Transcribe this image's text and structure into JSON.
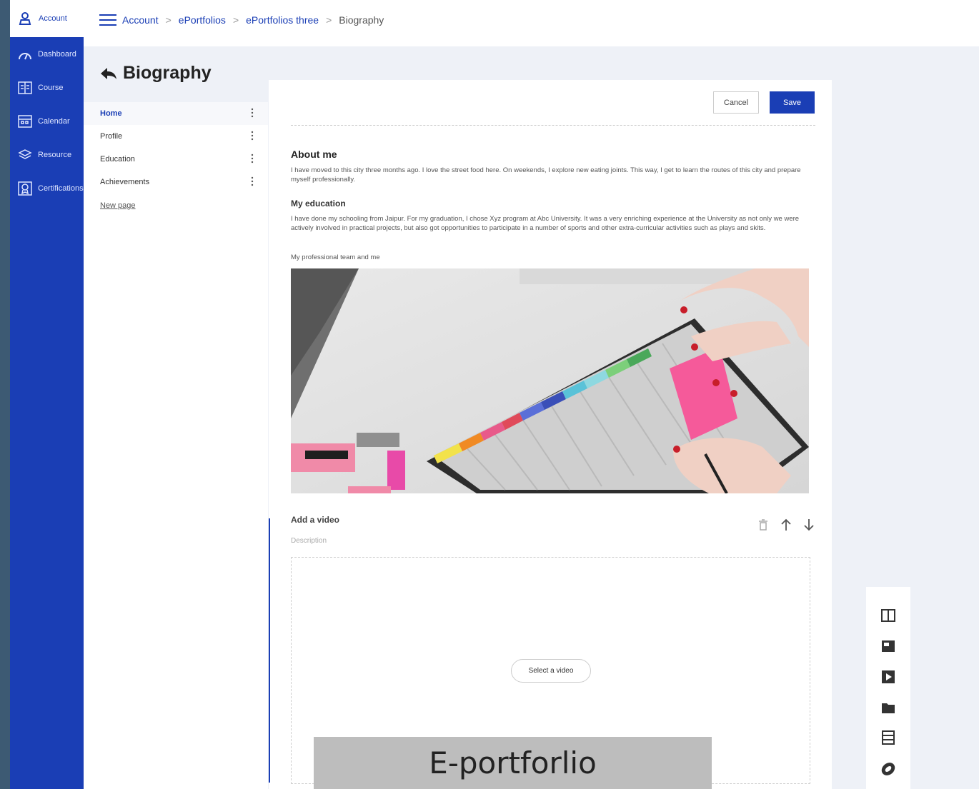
{
  "nav": {
    "account_label": "Account",
    "items": [
      {
        "label": "Dashboard",
        "icon": "dashboard-icon"
      },
      {
        "label": "Course",
        "icon": "course-icon"
      },
      {
        "label": "Calendar",
        "icon": "calendar-icon"
      },
      {
        "label": "Resource",
        "icon": "resource-icon"
      },
      {
        "label": "Certifications",
        "icon": "certifications-icon"
      }
    ]
  },
  "breadcrumb": {
    "items": [
      "Account",
      "ePortfolios",
      "ePortfolios three"
    ],
    "current": "Biography"
  },
  "page": {
    "title": "Biography"
  },
  "pages": {
    "items": [
      {
        "label": "Home",
        "active": true
      },
      {
        "label": "Profile"
      },
      {
        "label": "Education"
      },
      {
        "label": "Achievements"
      }
    ],
    "new_page": "New page"
  },
  "editor": {
    "cancel": "Cancel",
    "save": "Save",
    "about_title": "About me",
    "about_text": "I have moved to this city three months ago. I love the street food here. On weekends, I explore new eating joints. This way, I get to learn the routes of this city and prepare myself professionally.",
    "education_title": "My education",
    "education_text": "I have done my schooling from Jaipur. For my graduation, I chose Xyz program at Abc University. It was a very enriching experience at the University as not only we were actively involved in practical projects, but also got opportunities to participate in a number of sports and other extra-curricular activities such as plays and skits.",
    "image_caption": "My professional team and me",
    "video": {
      "title": "Add a video",
      "description_placeholder": "Description",
      "select_button": "Select a video"
    }
  },
  "palette": {
    "tools": [
      "columns-icon",
      "image-icon",
      "video-icon",
      "folder-icon",
      "file-list-icon",
      "link-icon"
    ]
  },
  "overlay": {
    "text": "E-portforlio"
  },
  "colors": {
    "primary": "#1a3eb5",
    "background": "#eef1f7",
    "frame": "#3d5a73"
  }
}
